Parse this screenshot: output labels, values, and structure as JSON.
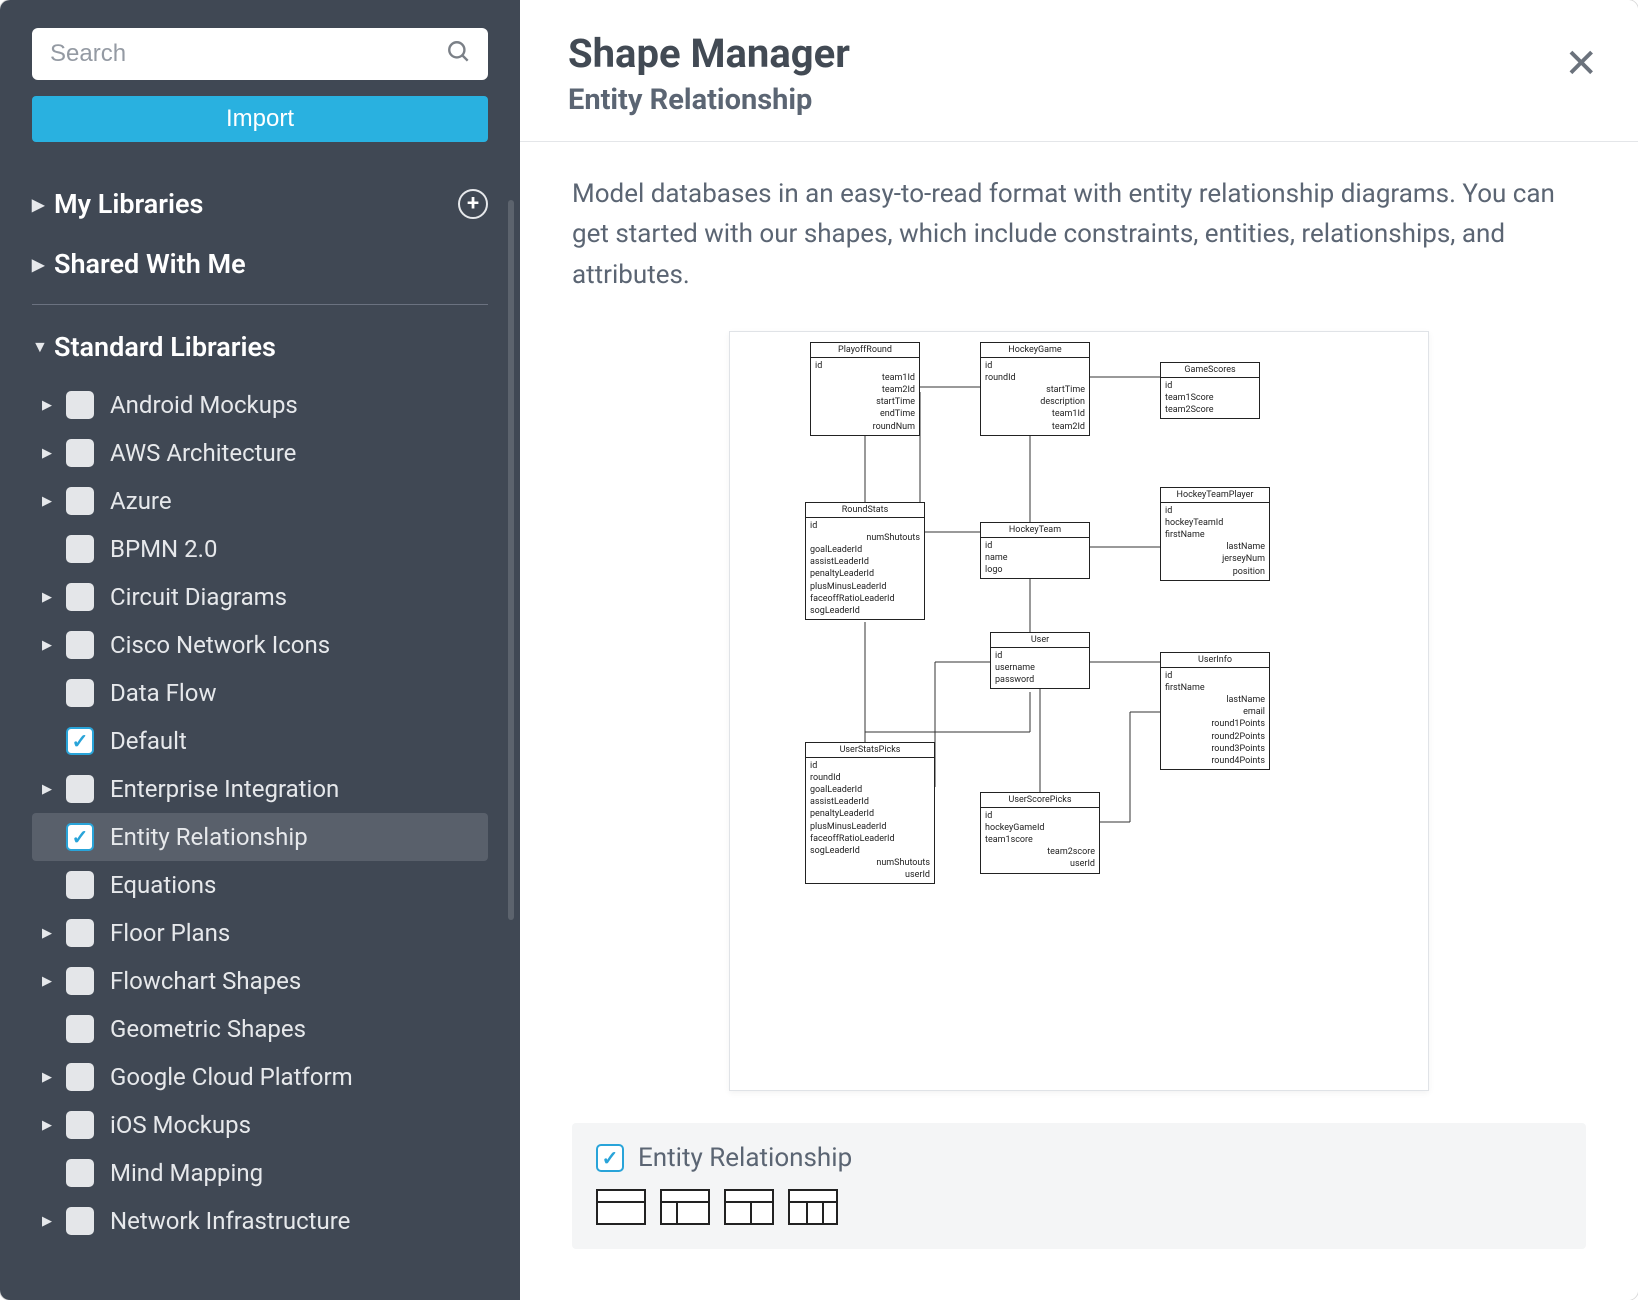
{
  "sidebar": {
    "search_placeholder": "Search",
    "import_label": "Import",
    "my_libraries_label": "My Libraries",
    "shared_label": "Shared With Me",
    "standard_label": "Standard Libraries",
    "items": [
      {
        "label": "Android Mockups",
        "expandable": true,
        "checked": false
      },
      {
        "label": "AWS Architecture",
        "expandable": true,
        "checked": false
      },
      {
        "label": "Azure",
        "expandable": true,
        "checked": false
      },
      {
        "label": "BPMN 2.0",
        "expandable": false,
        "checked": false
      },
      {
        "label": "Circuit Diagrams",
        "expandable": true,
        "checked": false
      },
      {
        "label": "Cisco Network Icons",
        "expandable": true,
        "checked": false
      },
      {
        "label": "Data Flow",
        "expandable": false,
        "checked": false
      },
      {
        "label": "Default",
        "expandable": false,
        "checked": true
      },
      {
        "label": "Enterprise Integration",
        "expandable": true,
        "checked": false
      },
      {
        "label": "Entity Relationship",
        "expandable": false,
        "checked": true,
        "selected": true
      },
      {
        "label": "Equations",
        "expandable": false,
        "checked": false
      },
      {
        "label": "Floor Plans",
        "expandable": true,
        "checked": false
      },
      {
        "label": "Flowchart Shapes",
        "expandable": true,
        "checked": false
      },
      {
        "label": "Geometric Shapes",
        "expandable": false,
        "checked": false
      },
      {
        "label": "Google Cloud Platform",
        "expandable": true,
        "checked": false
      },
      {
        "label": "iOS Mockups",
        "expandable": true,
        "checked": false
      },
      {
        "label": "Mind Mapping",
        "expandable": false,
        "checked": false
      },
      {
        "label": "Network Infrastructure",
        "expandable": true,
        "checked": false
      }
    ]
  },
  "header": {
    "title": "Shape Manager",
    "subtitle": "Entity Relationship"
  },
  "description": "Model databases in an easy-to-read format with entity relationship diagrams. You can get started with our shapes, which include constraints, entities, relationships, and attributes.",
  "preview_entities": {
    "playoffRound": {
      "title": "PlayoffRound",
      "fields": [
        "id",
        "team1Id",
        "team2Id",
        "startTime",
        "endTime",
        "roundNum"
      ]
    },
    "hockeyGame": {
      "title": "HockeyGame",
      "fields": [
        "id",
        "roundId",
        "startTime",
        "description",
        "team1Id",
        "team2Id"
      ]
    },
    "gameScores": {
      "title": "GameScores",
      "fields": [
        "id",
        "team1Score",
        "team2Score"
      ]
    },
    "roundStats": {
      "title": "RoundStats",
      "fields": [
        "id",
        "numShutouts",
        "goalLeaderId",
        "assistLeaderId",
        "penaltyLeaderId",
        "plusMinusLeaderId",
        "faceoffRatioLeaderId",
        "sogLeaderId"
      ]
    },
    "hockeyTeam": {
      "title": "HockeyTeam",
      "fields": [
        "id",
        "name",
        "logo"
      ]
    },
    "hockeyTeamPlayer": {
      "title": "HockeyTeamPlayer",
      "fields": [
        "id",
        "hockeyTeamId",
        "firstName",
        "lastName",
        "jerseyNum",
        "position"
      ]
    },
    "user": {
      "title": "User",
      "fields": [
        "id",
        "username",
        "password"
      ]
    },
    "userInfo": {
      "title": "UserInfo",
      "fields": [
        "id",
        "firstName",
        "lastName",
        "email",
        "round1Points",
        "round2Points",
        "round3Points",
        "round4Points"
      ]
    },
    "userStatsPicks": {
      "title": "UserStatsPicks",
      "fields": [
        "id",
        "roundId",
        "goalLeaderId",
        "assistLeaderId",
        "penaltyLeaderId",
        "plusMinusLeaderId",
        "faceoffRatioLeaderId",
        "sogLeaderId",
        "numShutouts",
        "userId"
      ]
    },
    "userScorePicks": {
      "title": "UserScorePicks",
      "fields": [
        "id",
        "hockeyGameId",
        "team1score",
        "team2score",
        "userId"
      ]
    }
  },
  "library_box": {
    "label": "Entity Relationship"
  }
}
